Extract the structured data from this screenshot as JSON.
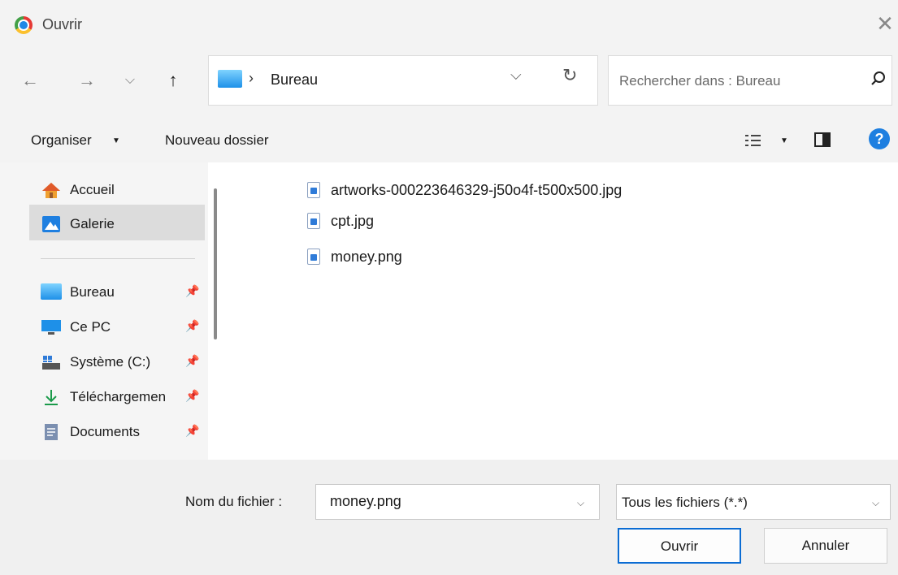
{
  "window": {
    "title": "Ouvrir"
  },
  "nav": {
    "back": "←",
    "forward": "→",
    "recent": "⌵",
    "up": "↑"
  },
  "address": {
    "separator": "›",
    "location": "Bureau"
  },
  "search": {
    "placeholder": "Rechercher dans : Bureau"
  },
  "toolbar": {
    "organise": "Organiser",
    "new_folder": "Nouveau dossier"
  },
  "sidebar": {
    "items": [
      {
        "label": "Accueil",
        "icon": "home-icon"
      },
      {
        "label": "Galerie",
        "icon": "gallery-icon",
        "selected": true
      },
      {
        "label": "Bureau",
        "icon": "desktop-folder-icon",
        "pinned": true
      },
      {
        "label": "Ce PC",
        "icon": "computer-icon",
        "pinned": true
      },
      {
        "label": "Système (C:)",
        "icon": "drive-icon",
        "pinned": true
      },
      {
        "label": "Téléchargemen",
        "icon": "download-icon",
        "pinned": true
      },
      {
        "label": "Documents",
        "icon": "documents-icon",
        "pinned": true
      }
    ]
  },
  "files": [
    {
      "name": "artworks-000223646329-j50o4f-t500x500.jpg"
    },
    {
      "name": "cpt.jpg"
    },
    {
      "name": "money.png"
    }
  ],
  "footer": {
    "filename_label": "Nom du fichier :",
    "filename_value": "money.png",
    "filter_value": "Tous les fichiers (*.*)",
    "open_label": "Ouvrir",
    "cancel_label": "Annuler"
  },
  "colors": {
    "accent": "#0b6cd3",
    "help": "#1e7fe0"
  }
}
